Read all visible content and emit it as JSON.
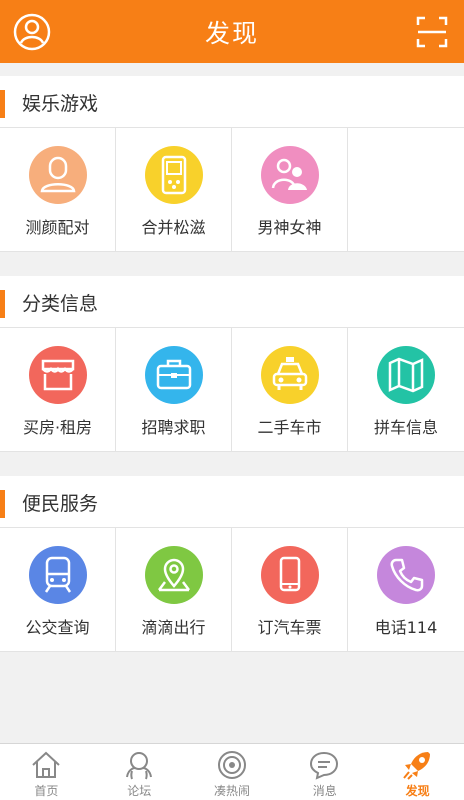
{
  "header": {
    "title": "发现"
  },
  "sections": [
    {
      "title": "娱乐游戏",
      "items": [
        {
          "label": "测颜配对"
        },
        {
          "label": "合并松滋"
        },
        {
          "label": "男神女神"
        }
      ]
    },
    {
      "title": "分类信息",
      "items": [
        {
          "label": "买房·租房"
        },
        {
          "label": "招聘求职"
        },
        {
          "label": "二手车市"
        },
        {
          "label": "拼车信息"
        }
      ]
    },
    {
      "title": "便民服务",
      "items": [
        {
          "label": "公交查询"
        },
        {
          "label": "滴滴出行"
        },
        {
          "label": "订汽车票"
        },
        {
          "label": "电话114"
        }
      ]
    }
  ],
  "tabbar": [
    {
      "label": "首页"
    },
    {
      "label": "论坛"
    },
    {
      "label": "凑热闹"
    },
    {
      "label": "消息"
    },
    {
      "label": "发现"
    }
  ],
  "colors": {
    "accent": "#f77f16",
    "icon_peach": "#f7ae7c",
    "icon_yellow": "#f8d12b",
    "icon_pink": "#f08ec0",
    "icon_red": "#f2675c",
    "icon_blue": "#34b5ec",
    "icon_teal": "#23c3a5",
    "icon_indigo": "#5a86e5",
    "icon_green": "#7fc842",
    "icon_purple": "#c587dc"
  }
}
